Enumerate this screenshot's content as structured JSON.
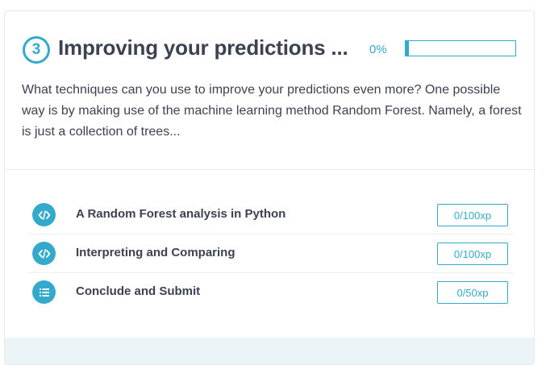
{
  "chapter": {
    "number": "3",
    "title": "Improving your predictions ...",
    "progress_label": "0%",
    "progress_fraction": 0.03,
    "description": "What techniques can you use to improve your predictions even more? One possible way is by making use of the machine learning method Random Forest. Namely, a forest is just a collection of trees..."
  },
  "exercises": [
    {
      "title": "A Random Forest analysis in Python",
      "xp": "0/100xp",
      "icon": "code-icon"
    },
    {
      "title": "Interpreting and Comparing",
      "xp": "0/100xp",
      "icon": "code-icon"
    },
    {
      "title": "Conclude and Submit",
      "xp": "0/50xp",
      "icon": "list-icon"
    }
  ],
  "colors": {
    "accent": "#33aacc",
    "text": "#3d4251",
    "footer": "#ebf4f7"
  }
}
